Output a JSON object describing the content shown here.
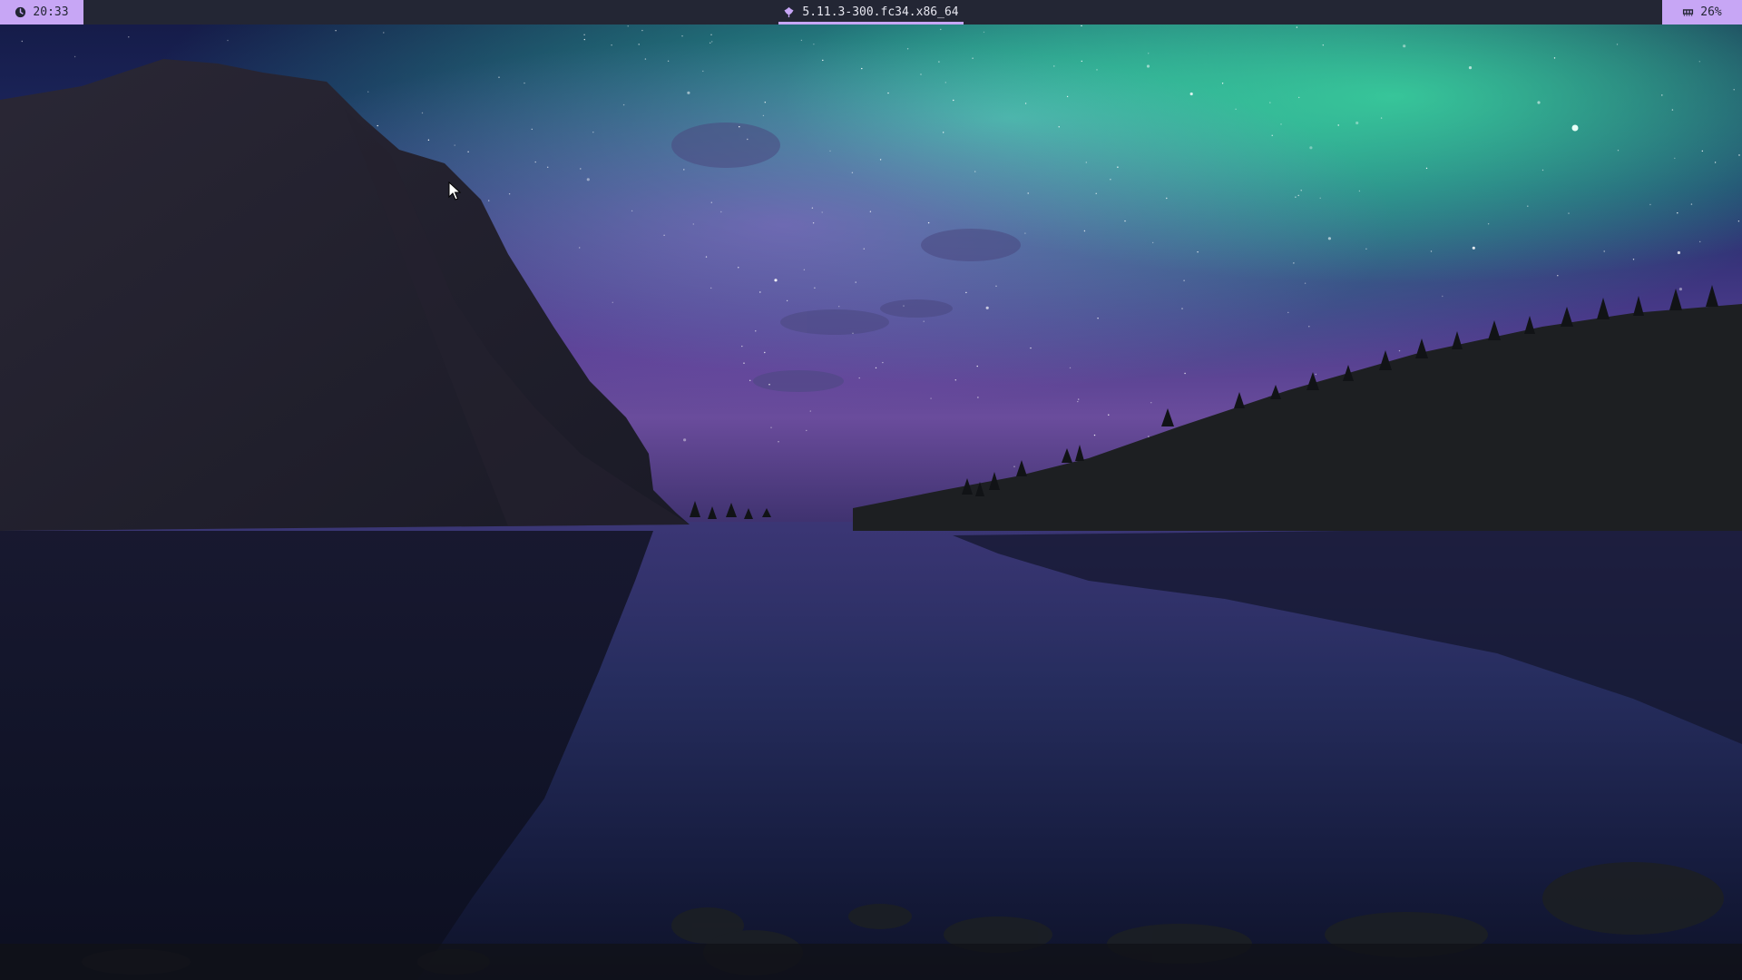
{
  "topbar": {
    "clock": {
      "icon": "clock-icon",
      "time": "20:33"
    },
    "kernel": {
      "icon": "fedora-leaf-icon",
      "label": "5.11.3-300.fc34.x86_64"
    },
    "memory": {
      "icon": "memory-chip-icon",
      "value": "26%"
    }
  },
  "colors": {
    "bar_bg": "#232634",
    "accent": "#c7a6f5",
    "bar_text": "#e6e6ef"
  },
  "wallpaper": {
    "scene": "aurora over mountain lake at night"
  }
}
